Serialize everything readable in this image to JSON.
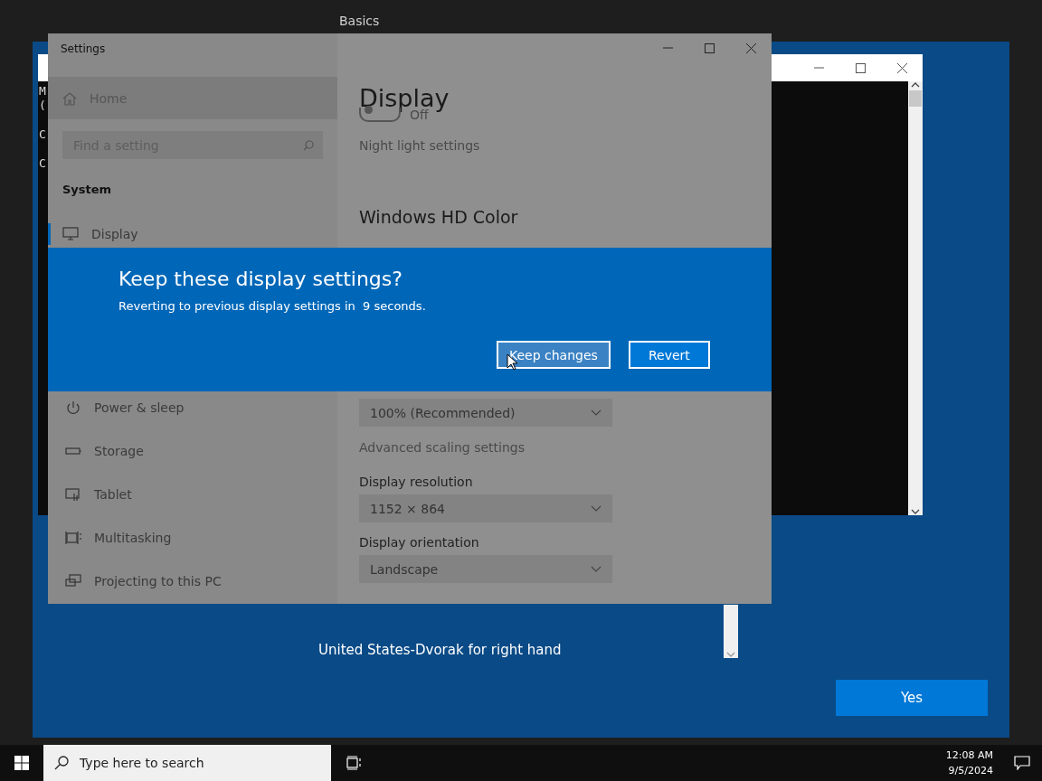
{
  "desktop": {
    "caption": "Basics"
  },
  "setup_window": {
    "console": {
      "lines": [
        "M",
        "(",
        "C",
        "C"
      ]
    },
    "keyboard_layouts": [
      {
        "label": "United States-Dvorak for right hand"
      }
    ],
    "buttons": [
      {
        "label": "Yes"
      }
    ]
  },
  "settings_window": {
    "title": "Settings",
    "home": "Home",
    "search": {
      "placeholder": "Find a setting"
    },
    "section": "System",
    "nav_items": [
      {
        "label": "Display",
        "kind": "monitor",
        "selected": true
      },
      {
        "label": "Power & sleep",
        "kind": "power",
        "selected": false
      },
      {
        "label": "Storage",
        "kind": "storage",
        "selected": false
      },
      {
        "label": "Tablet",
        "kind": "tablet",
        "selected": false
      },
      {
        "label": "Multitasking",
        "kind": "multitasking",
        "selected": false
      },
      {
        "label": "Projecting to this PC",
        "kind": "projecting",
        "selected": false
      }
    ],
    "page_title": "Display",
    "night_light": {
      "on": false,
      "state_label": "Off",
      "link": "Night light settings"
    },
    "hd_color_heading": "Windows HD Color",
    "scale": {
      "value": "100% (Recommended)",
      "link": "Advanced scaling settings"
    },
    "resolution": {
      "label": "Display resolution",
      "value": "1152 × 864"
    },
    "orientation": {
      "label": "Display orientation",
      "value": "Landscape"
    }
  },
  "dialog": {
    "title": "Keep these display settings?",
    "message": "Reverting to previous display settings in  9 seconds.",
    "buttons": [
      {
        "label": "Keep changes",
        "hovered": true
      },
      {
        "label": "Revert",
        "hovered": false
      }
    ]
  },
  "taskbar": {
    "search": {
      "placeholder": "Type here to search"
    },
    "time": "12:08 AM",
    "date": "9/5/2024"
  }
}
